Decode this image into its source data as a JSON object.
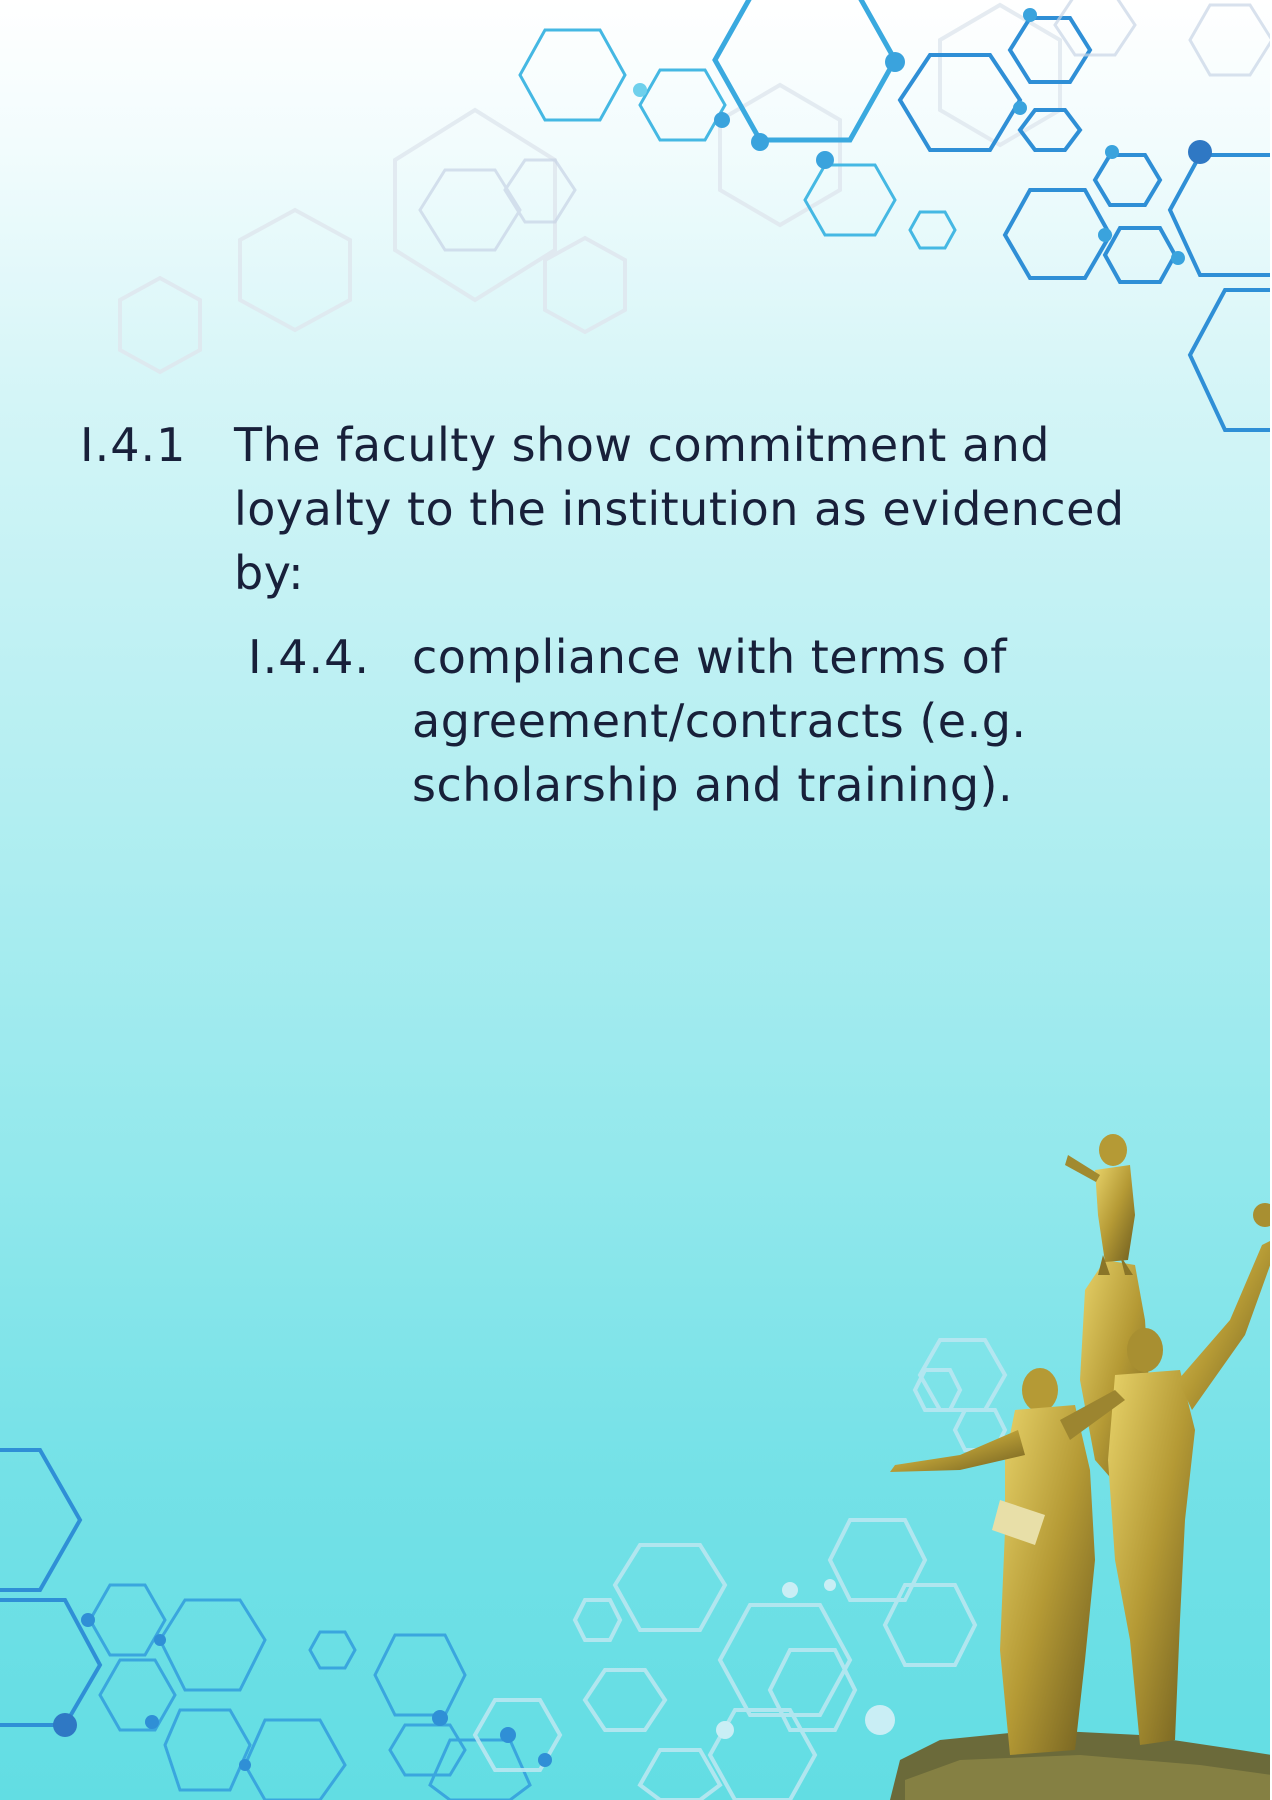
{
  "section": {
    "number": "I.4.1",
    "lines": [
      "The faculty show commitment and",
      "loyalty to the institution as evidenced",
      "by:"
    ]
  },
  "item": {
    "number": "I.4.4.",
    "lines": [
      "compliance with terms of",
      "agreement/contracts (e.g.",
      "scholarship and training)."
    ]
  },
  "colors": {
    "text": "#18203a",
    "hex_accent": "#2f8fd6",
    "hex_light": "#8fd6ef",
    "statue_gold": "#b9a23c"
  },
  "decorations": [
    "hexagon-network-pattern",
    "golden-statue-monument"
  ]
}
